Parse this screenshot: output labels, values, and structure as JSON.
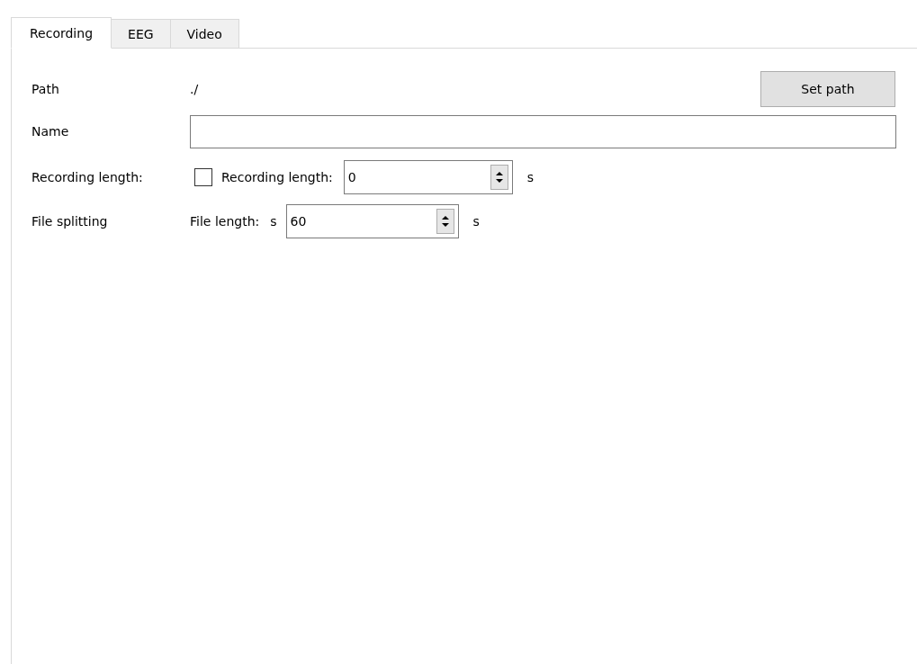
{
  "tabs": [
    {
      "label": "Recording",
      "selected": true
    },
    {
      "label": "EEG",
      "selected": false
    },
    {
      "label": "Video",
      "selected": false
    }
  ],
  "path": {
    "label": "Path",
    "value": "./",
    "button": "Set path"
  },
  "name": {
    "label": "Name"
  },
  "recording_length": {
    "label": "Recording length:",
    "checked": false,
    "field_label": "Recording length:",
    "value": "0",
    "unit": "s"
  },
  "file_splitting": {
    "label": "File splitting",
    "field_label": "File length:",
    "prefix": "s",
    "value": "60",
    "unit": "s"
  }
}
